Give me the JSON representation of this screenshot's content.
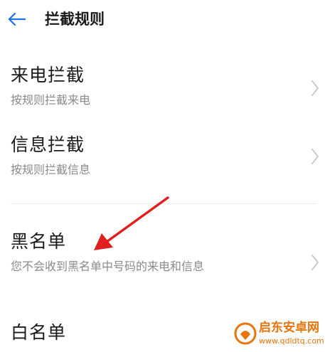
{
  "header": {
    "title": "拦截规则",
    "back_icon": "arrow-left-icon"
  },
  "items": [
    {
      "title": "来电拦截",
      "subtitle": "按规则拦截来电"
    },
    {
      "title": "信息拦截",
      "subtitle": "按规则拦截信息"
    },
    {
      "title": "黑名单",
      "subtitle": "您不会收到黑名单中号码的来电和信息"
    },
    {
      "title": "白名单",
      "subtitle": ""
    }
  ],
  "annotation": {
    "color": "#e02020"
  },
  "watermark": {
    "title": "启东安卓网",
    "url": "www.qdldtq.com",
    "color": "#e8740c"
  },
  "colors": {
    "accent": "#1a73e8",
    "title_text": "#1a1a1a",
    "subtitle_text": "#8a8a8a",
    "chevron": "#c4c4c4"
  }
}
